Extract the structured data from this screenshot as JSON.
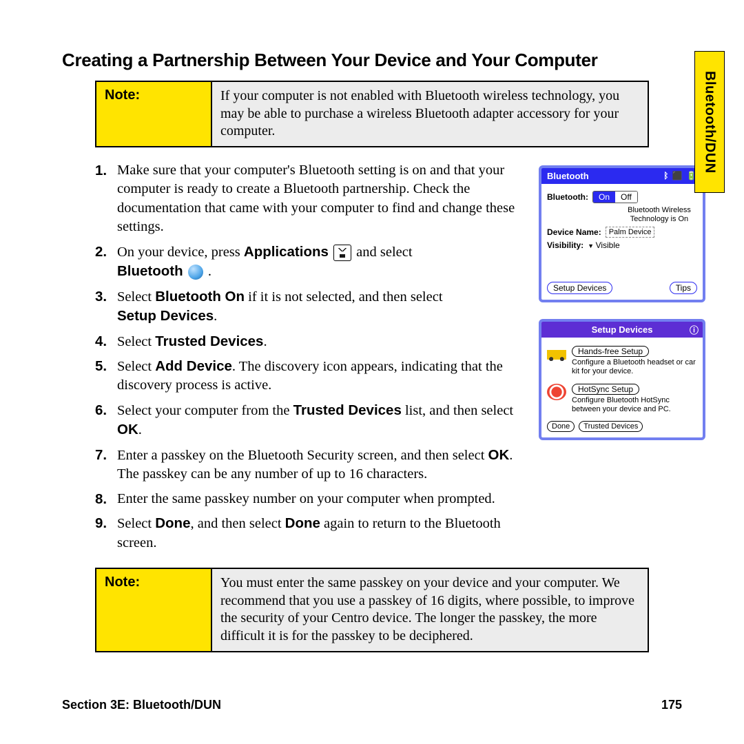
{
  "sideTab": "Bluetooth/DUN",
  "heading": "Creating a Partnership Between Your Device and Your Computer",
  "note1": {
    "label": "Note:",
    "text": "If your computer is not enabled with Bluetooth wireless technology, you may be able to purchase a wireless Bluetooth adapter accessory for your computer."
  },
  "steps": {
    "s1": "Make sure that your computer's Bluetooth setting is on and that your computer is ready to create a Bluetooth partnership. Check the documentation that came with your computer to find and change these settings.",
    "s2a": "On your device, press ",
    "s2b": "Applications",
    "s2c": " and select ",
    "s2d": "Bluetooth",
    "s2e": " .",
    "s3a": "Select ",
    "s3b": "Bluetooth On",
    "s3c": " if it is not selected, and then select ",
    "s3d": "Setup Devices",
    "s3e": ".",
    "s4a": "Select ",
    "s4b": "Trusted Devices",
    "s4c": ".",
    "s5a": "Select ",
    "s5b": "Add Device",
    "s5c": ". The discovery icon appears, indicating that the discovery process is active.",
    "s6a": "Select your computer from the ",
    "s6b": "Trusted Devices",
    "s6c": " list, and then select ",
    "s6d": "OK",
    "s6e": ".",
    "s7a": "Enter a passkey on the Bluetooth Security screen, and then select ",
    "s7b": "OK",
    "s7c": ". The passkey can be any number of up to 16 characters.",
    "s8": "Enter the same passkey number on your computer when prompted.",
    "s9a": "Select ",
    "s9b": "Done",
    "s9c": ", and then select ",
    "s9d": "Done",
    "s9e": " again to return to the Bluetooth screen."
  },
  "note2": {
    "label": "Note:",
    "text": "You must enter the same passkey on your device and your computer. We recommend that you use a passkey of 16 digits, where possible, to improve the security of your Centro device. The longer the passkey, the more difficult it is for the passkey to be deciphered."
  },
  "fig1": {
    "title": "Bluetooth",
    "btLabel": "Bluetooth:",
    "on": "On",
    "off": "Off",
    "hint": "Bluetooth Wireless Technology is On",
    "devNameLabel": "Device Name:",
    "devName": "Palm Device",
    "visLabel": "Visibility:",
    "vis": "Visible",
    "setup": "Setup Devices",
    "tips": "Tips"
  },
  "fig2": {
    "title": "Setup Devices",
    "info": "ⓘ",
    "opt1t": "Hands-free Setup",
    "opt1d": "Configure a Bluetooth headset or car kit for your device.",
    "opt2t": "HotSync Setup",
    "opt2d": "Configure Bluetooth HotSync between your device and PC.",
    "done": "Done",
    "trusted": "Trusted Devices"
  },
  "footer": {
    "left": "Section 3E: Bluetooth/DUN",
    "right": "175"
  }
}
